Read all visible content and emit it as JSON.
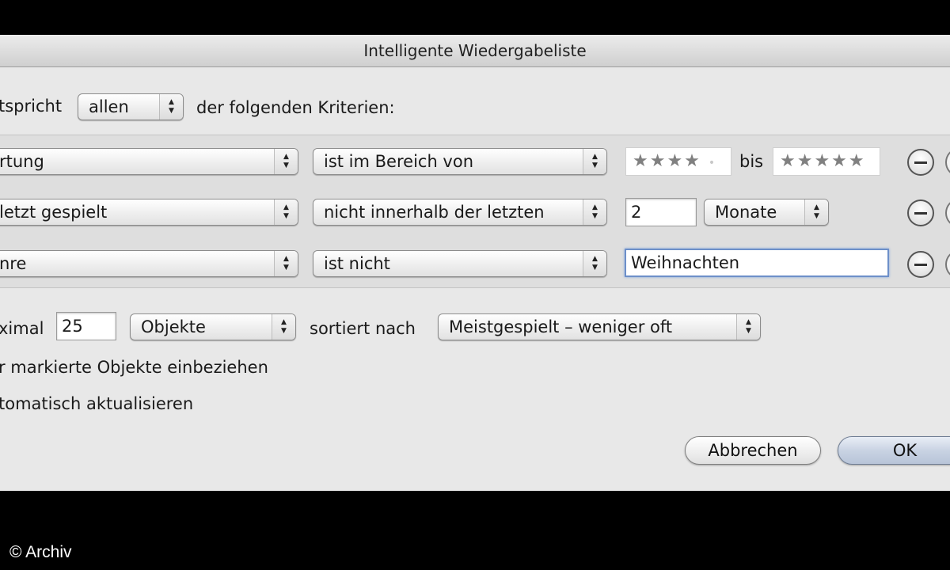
{
  "dialog": {
    "title": "Intelligente Wiedergabeliste",
    "match_prefix": "tspricht",
    "match_value": "allen",
    "match_suffix": "der folgenden Kriterien:"
  },
  "rules": [
    {
      "field": "rtung",
      "operator": "ist im Bereich von",
      "value_from_stars": "★★★★",
      "value_from_dot": "•",
      "between_label": "bis",
      "value_to_stars": "★★★★★"
    },
    {
      "field": "letzt gespielt",
      "operator": "nicht innerhalb der letzten",
      "value": "2",
      "unit": "Monate"
    },
    {
      "field": "nre",
      "operator": "ist nicht",
      "value": "Weihnachten"
    }
  ],
  "limit": {
    "prefix": "ximal",
    "value": "25",
    "unit": "Objekte",
    "sort_label": "sortiert nach",
    "sort_value": "Meistgespielt – weniger oft"
  },
  "options": {
    "checked_only": "r markierte Objekte einbeziehen",
    "live_update": "tomatisch aktualisieren"
  },
  "buttons": {
    "cancel": "Abbrechen",
    "ok": "OK"
  },
  "copyright": "© Archiv"
}
